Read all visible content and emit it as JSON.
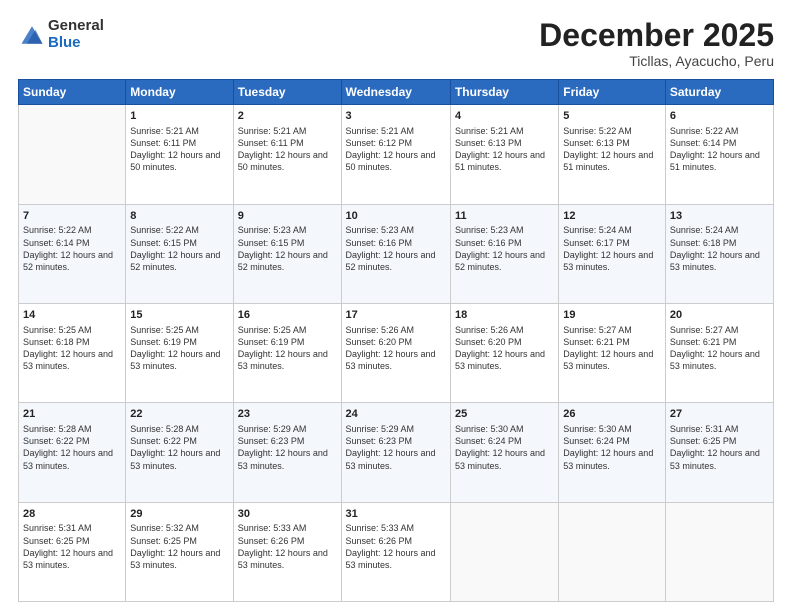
{
  "header": {
    "logo_general": "General",
    "logo_blue": "Blue",
    "month": "December 2025",
    "location": "Ticllas, Ayacucho, Peru"
  },
  "days_of_week": [
    "Sunday",
    "Monday",
    "Tuesday",
    "Wednesday",
    "Thursday",
    "Friday",
    "Saturday"
  ],
  "weeks": [
    [
      {
        "day": "",
        "sunrise": "",
        "sunset": "",
        "daylight": ""
      },
      {
        "day": "1",
        "sunrise": "Sunrise: 5:21 AM",
        "sunset": "Sunset: 6:11 PM",
        "daylight": "Daylight: 12 hours and 50 minutes."
      },
      {
        "day": "2",
        "sunrise": "Sunrise: 5:21 AM",
        "sunset": "Sunset: 6:11 PM",
        "daylight": "Daylight: 12 hours and 50 minutes."
      },
      {
        "day": "3",
        "sunrise": "Sunrise: 5:21 AM",
        "sunset": "Sunset: 6:12 PM",
        "daylight": "Daylight: 12 hours and 50 minutes."
      },
      {
        "day": "4",
        "sunrise": "Sunrise: 5:21 AM",
        "sunset": "Sunset: 6:13 PM",
        "daylight": "Daylight: 12 hours and 51 minutes."
      },
      {
        "day": "5",
        "sunrise": "Sunrise: 5:22 AM",
        "sunset": "Sunset: 6:13 PM",
        "daylight": "Daylight: 12 hours and 51 minutes."
      },
      {
        "day": "6",
        "sunrise": "Sunrise: 5:22 AM",
        "sunset": "Sunset: 6:14 PM",
        "daylight": "Daylight: 12 hours and 51 minutes."
      }
    ],
    [
      {
        "day": "7",
        "sunrise": "Sunrise: 5:22 AM",
        "sunset": "Sunset: 6:14 PM",
        "daylight": "Daylight: 12 hours and 52 minutes."
      },
      {
        "day": "8",
        "sunrise": "Sunrise: 5:22 AM",
        "sunset": "Sunset: 6:15 PM",
        "daylight": "Daylight: 12 hours and 52 minutes."
      },
      {
        "day": "9",
        "sunrise": "Sunrise: 5:23 AM",
        "sunset": "Sunset: 6:15 PM",
        "daylight": "Daylight: 12 hours and 52 minutes."
      },
      {
        "day": "10",
        "sunrise": "Sunrise: 5:23 AM",
        "sunset": "Sunset: 6:16 PM",
        "daylight": "Daylight: 12 hours and 52 minutes."
      },
      {
        "day": "11",
        "sunrise": "Sunrise: 5:23 AM",
        "sunset": "Sunset: 6:16 PM",
        "daylight": "Daylight: 12 hours and 52 minutes."
      },
      {
        "day": "12",
        "sunrise": "Sunrise: 5:24 AM",
        "sunset": "Sunset: 6:17 PM",
        "daylight": "Daylight: 12 hours and 53 minutes."
      },
      {
        "day": "13",
        "sunrise": "Sunrise: 5:24 AM",
        "sunset": "Sunset: 6:18 PM",
        "daylight": "Daylight: 12 hours and 53 minutes."
      }
    ],
    [
      {
        "day": "14",
        "sunrise": "Sunrise: 5:25 AM",
        "sunset": "Sunset: 6:18 PM",
        "daylight": "Daylight: 12 hours and 53 minutes."
      },
      {
        "day": "15",
        "sunrise": "Sunrise: 5:25 AM",
        "sunset": "Sunset: 6:19 PM",
        "daylight": "Daylight: 12 hours and 53 minutes."
      },
      {
        "day": "16",
        "sunrise": "Sunrise: 5:25 AM",
        "sunset": "Sunset: 6:19 PM",
        "daylight": "Daylight: 12 hours and 53 minutes."
      },
      {
        "day": "17",
        "sunrise": "Sunrise: 5:26 AM",
        "sunset": "Sunset: 6:20 PM",
        "daylight": "Daylight: 12 hours and 53 minutes."
      },
      {
        "day": "18",
        "sunrise": "Sunrise: 5:26 AM",
        "sunset": "Sunset: 6:20 PM",
        "daylight": "Daylight: 12 hours and 53 minutes."
      },
      {
        "day": "19",
        "sunrise": "Sunrise: 5:27 AM",
        "sunset": "Sunset: 6:21 PM",
        "daylight": "Daylight: 12 hours and 53 minutes."
      },
      {
        "day": "20",
        "sunrise": "Sunrise: 5:27 AM",
        "sunset": "Sunset: 6:21 PM",
        "daylight": "Daylight: 12 hours and 53 minutes."
      }
    ],
    [
      {
        "day": "21",
        "sunrise": "Sunrise: 5:28 AM",
        "sunset": "Sunset: 6:22 PM",
        "daylight": "Daylight: 12 hours and 53 minutes."
      },
      {
        "day": "22",
        "sunrise": "Sunrise: 5:28 AM",
        "sunset": "Sunset: 6:22 PM",
        "daylight": "Daylight: 12 hours and 53 minutes."
      },
      {
        "day": "23",
        "sunrise": "Sunrise: 5:29 AM",
        "sunset": "Sunset: 6:23 PM",
        "daylight": "Daylight: 12 hours and 53 minutes."
      },
      {
        "day": "24",
        "sunrise": "Sunrise: 5:29 AM",
        "sunset": "Sunset: 6:23 PM",
        "daylight": "Daylight: 12 hours and 53 minutes."
      },
      {
        "day": "25",
        "sunrise": "Sunrise: 5:30 AM",
        "sunset": "Sunset: 6:24 PM",
        "daylight": "Daylight: 12 hours and 53 minutes."
      },
      {
        "day": "26",
        "sunrise": "Sunrise: 5:30 AM",
        "sunset": "Sunset: 6:24 PM",
        "daylight": "Daylight: 12 hours and 53 minutes."
      },
      {
        "day": "27",
        "sunrise": "Sunrise: 5:31 AM",
        "sunset": "Sunset: 6:25 PM",
        "daylight": "Daylight: 12 hours and 53 minutes."
      }
    ],
    [
      {
        "day": "28",
        "sunrise": "Sunrise: 5:31 AM",
        "sunset": "Sunset: 6:25 PM",
        "daylight": "Daylight: 12 hours and 53 minutes."
      },
      {
        "day": "29",
        "sunrise": "Sunrise: 5:32 AM",
        "sunset": "Sunset: 6:25 PM",
        "daylight": "Daylight: 12 hours and 53 minutes."
      },
      {
        "day": "30",
        "sunrise": "Sunrise: 5:33 AM",
        "sunset": "Sunset: 6:26 PM",
        "daylight": "Daylight: 12 hours and 53 minutes."
      },
      {
        "day": "31",
        "sunrise": "Sunrise: 5:33 AM",
        "sunset": "Sunset: 6:26 PM",
        "daylight": "Daylight: 12 hours and 53 minutes."
      },
      {
        "day": "",
        "sunrise": "",
        "sunset": "",
        "daylight": ""
      },
      {
        "day": "",
        "sunrise": "",
        "sunset": "",
        "daylight": ""
      },
      {
        "day": "",
        "sunrise": "",
        "sunset": "",
        "daylight": ""
      }
    ]
  ]
}
